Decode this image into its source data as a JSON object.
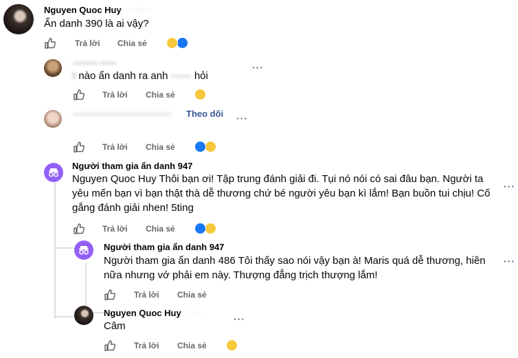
{
  "actions": {
    "reply": "Trả lời",
    "share": "Chia sẻ"
  },
  "colors": {
    "anon_avatar": "#9360f7",
    "link_blue": "#385898",
    "haha": "#f7c83c",
    "like": "#1877f2"
  },
  "comments": [
    {
      "name": "Nguyen Quoc Huy",
      "text": "Ẩn danh 390 là ai vậy?"
    },
    {
      "name": "",
      "text": "nào ẩn danh ra anh",
      "text_end": "hỏi"
    },
    {
      "name": "",
      "follow": "Theo dõi",
      "text": ""
    },
    {
      "name": "Người tham gia ẩn danh 947",
      "text": "Nguyen Quoc Huy Thôi bạn ơi! Tập trung đánh giải đi. Tụi nó nói có sai đâu bạn. Người ta yêu mến bạn vì bạn thật thà dễ thương chứ bé người yêu bạn kì lắm! Bạn buồn tui chịu! Cố gắng đánh giải nhen! 5ting"
    },
    {
      "name": "Người tham gia ẩn danh 947",
      "text": "Người tham gia ẩn danh 486 Tôi thấy sao nói vậy bạn à! Maris quá dễ thương, hiền nữa nhưng vớ phải em này. Thượng đẳng trịch thượng lắm!"
    },
    {
      "name": "Nguyen Quoc Huy",
      "text": "Câm"
    }
  ],
  "icons": {
    "like": "like-icon",
    "more": "more-icon",
    "haha": "haha-reaction-icon",
    "like_reaction": "like-reaction-icon",
    "anon": "anonymous-avatar-icon"
  }
}
